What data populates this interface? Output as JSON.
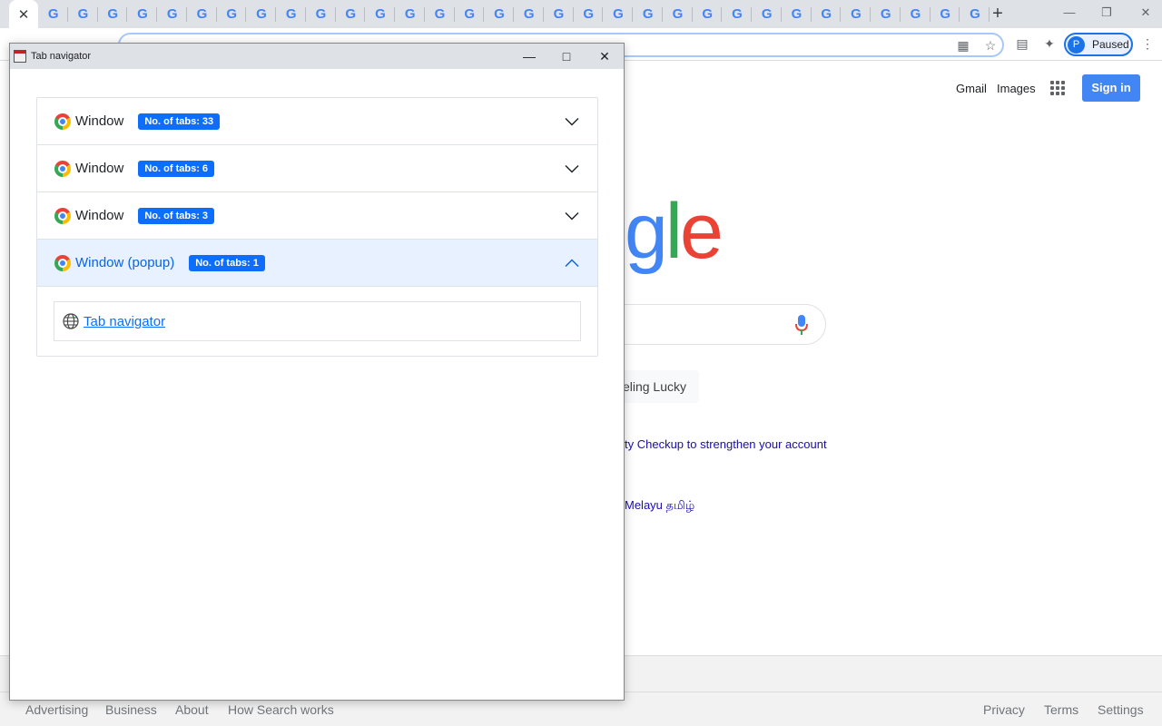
{
  "browser": {
    "tab_count_in_strip": 33,
    "new_tab_label": "+"
  },
  "toolbar": {
    "profile_initial": "P",
    "profile_status": "Paused"
  },
  "google_page": {
    "gmail": "Gmail",
    "images": "Images",
    "sign_in": "Sign in",
    "logo_tail": "gle",
    "lucky_partial": "eeling Lucky",
    "checkup_partial": "ty Checkup to strengthen your account",
    "languages_partial": "Melayu  தமிழ்",
    "footer": {
      "advertising": "Advertising",
      "business": "Business",
      "about": "About",
      "how_search_works": "How Search works",
      "privacy": "Privacy",
      "terms": "Terms",
      "settings": "Settings"
    }
  },
  "popup": {
    "title": "Tab navigator",
    "windows": [
      {
        "label": "Window",
        "badge": "No. of tabs: 33",
        "expanded": false
      },
      {
        "label": "Window",
        "badge": "No. of tabs: 6",
        "expanded": false
      },
      {
        "label": "Window",
        "badge": "No. of tabs: 3",
        "expanded": false
      },
      {
        "label": "Window (popup)",
        "badge": "No. of tabs: 1",
        "expanded": true,
        "tabs": [
          {
            "title": "Tab navigator"
          }
        ]
      }
    ]
  },
  "colors": {
    "accent": "#0d6efd",
    "expanded_header_bg": "#e7f1ff",
    "signin_blue": "#4285f4"
  }
}
